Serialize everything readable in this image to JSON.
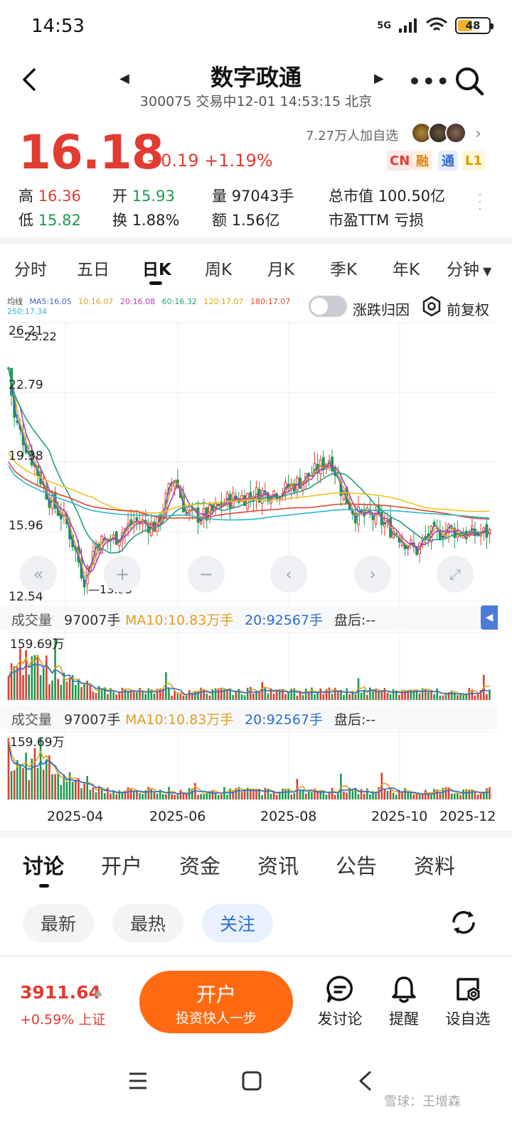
{
  "status_bar": {
    "time": "14:53",
    "network": "5G",
    "battery": "48"
  },
  "header": {
    "title": "数字政通",
    "subtitle": "300075 交易中12-01 14:53:15 北京"
  },
  "quote": {
    "price": "16.18",
    "change": "+0.19  +1.19%",
    "watchers": "7.27万人加自选",
    "badges": [
      "CN",
      "融",
      "通",
      "L1"
    ]
  },
  "stats": {
    "high_label": "高",
    "high": "16.36",
    "low_label": "低",
    "low": "15.82",
    "open_label": "开",
    "open": "15.93",
    "turnover_label": "换",
    "turnover": "1.88%",
    "volume_label": "量",
    "volume": "97043手",
    "amount_label": "额",
    "amount": "1.56亿",
    "mcap_label": "总市值",
    "mcap": "100.50亿",
    "pe_label": "市盈TTM",
    "pe": "亏损"
  },
  "period_tabs": [
    "分时",
    "五日",
    "日K",
    "周K",
    "月K",
    "季K",
    "年K",
    "分钟"
  ],
  "active_period": "日K",
  "ma_legend": {
    "label": "均线",
    "ma5": "MA5:16.05",
    "ma10": "10:16.07",
    "ma20": "20:16.08",
    "ma60": "60:16.32",
    "ma120": "120:17.07",
    "ma180": "180:17.07",
    "ma250": "250:17.34"
  },
  "toggle_label": "涨跌归因",
  "restore_label": "前复权",
  "chart_data": {
    "type": "line",
    "title": "",
    "y_axis_labels": [
      "26.21",
      "22.79",
      "19.38",
      "15.96",
      "12.54"
    ],
    "ylim": [
      12.54,
      26.21
    ],
    "high_marker": "25.22",
    "low_marker": "13.53",
    "x_axis_labels": [
      "2025-04",
      "2025-06",
      "2025-08",
      "2025-10",
      "2025-12"
    ],
    "series": [
      {
        "name": "MA5",
        "color": "#3c62c9"
      },
      {
        "name": "MA10",
        "color": "#e0a020"
      },
      {
        "name": "MA20",
        "color": "#b23cb8"
      },
      {
        "name": "MA60",
        "color": "#21a07d"
      },
      {
        "name": "MA120",
        "color": "#f0c021"
      },
      {
        "name": "MA180",
        "color": "#e0452d"
      },
      {
        "name": "MA250",
        "color": "#27b6d0"
      }
    ],
    "volume_max_label": "159.69万"
  },
  "volume_panel": {
    "label": "成交量",
    "value": "97007手",
    "ma10": "MA10:10.83万手",
    "ma20": "20:92567手",
    "after_hours": "盘后:--"
  },
  "bottom_tabs": [
    "讨论",
    "开户",
    "资金",
    "资讯",
    "公告",
    "资料"
  ],
  "filters": [
    "最新",
    "最热",
    "关注"
  ],
  "bottom_bar": {
    "index_value": "3911.64",
    "index_change": "+0.59% 上证",
    "open_title": "开户",
    "open_sub": "投资快人一步",
    "actions": [
      "发讨论",
      "提醒",
      "设自选"
    ]
  },
  "watermark": "雪球：王增森",
  "colors": {
    "up": "#e23b32",
    "down": "#1a9a4d",
    "accent": "#ff6a13"
  }
}
